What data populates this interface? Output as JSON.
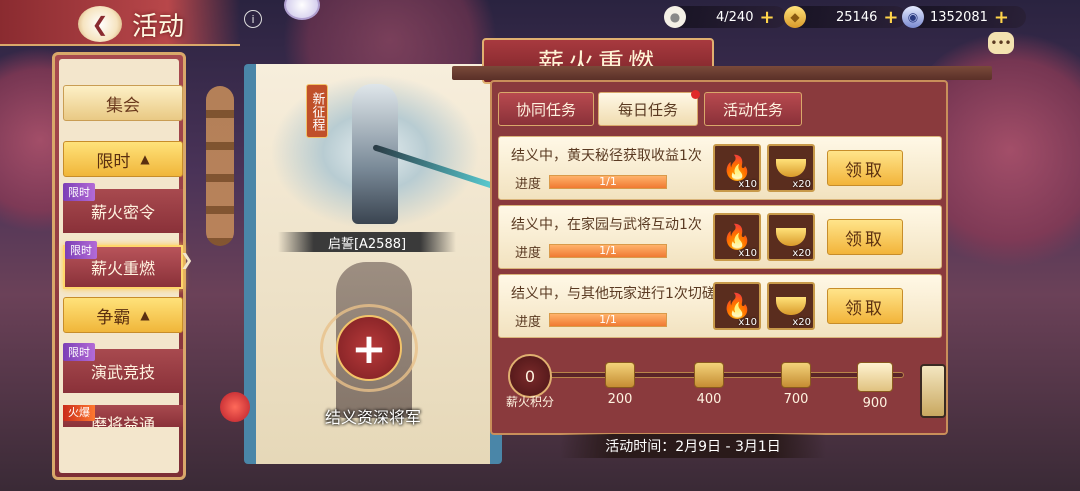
{
  "header": {
    "title": "活动"
  },
  "resources": [
    {
      "value": "4/240",
      "icon": "bun-icon"
    },
    {
      "value": "25146",
      "icon": "gold-ingot-icon"
    },
    {
      "value": "1352081",
      "icon": "silver-coin-icon"
    }
  ],
  "sidebar": {
    "groups": [
      {
        "label": "集会"
      },
      {
        "label": "限时",
        "chevron": "▲"
      },
      {
        "label": "争霸",
        "chevron": "▲"
      }
    ],
    "items": [
      {
        "tag": "限时",
        "label": "薪火密令"
      },
      {
        "tag": "限时",
        "label": "薪火重燃"
      },
      {
        "tag": "限时",
        "label": "演武竞技"
      },
      {
        "tag": "火爆",
        "label": "磨将益通"
      }
    ]
  },
  "hero": {
    "badge": "新征程",
    "name": "启誓[A2588]",
    "add_label": "结义资深将军"
  },
  "event": {
    "banner": "薪火重燃",
    "tabs": [
      "协同任务",
      "每日任务",
      "活动任务"
    ],
    "active_tab": 1,
    "tasks": [
      {
        "title": "结义中，黄天秘径获取收益1次",
        "progress_label": "进度",
        "progress": "1/1",
        "progress_fraction": 1.0,
        "rewards": [
          {
            "icon": "fire-bowl-icon",
            "qty": "x10"
          },
          {
            "icon": "gold-ingot-icon",
            "qty": "x20"
          }
        ],
        "button": "领取"
      },
      {
        "title": "结义中，在家园与武将互动1次",
        "progress_label": "进度",
        "progress": "1/1",
        "progress_fraction": 1.0,
        "rewards": [
          {
            "icon": "fire-bowl-icon",
            "qty": "x10"
          },
          {
            "icon": "gold-ingot-icon",
            "qty": "x20"
          }
        ],
        "button": "领取"
      },
      {
        "title": "结义中，与其他玩家进行1次切磋",
        "progress_label": "进度",
        "progress": "1/1",
        "progress_fraction": 1.0,
        "rewards": [
          {
            "icon": "fire-bowl-icon",
            "qty": "x10"
          },
          {
            "icon": "gold-ingot-icon",
            "qty": "x20"
          }
        ],
        "button": "领取"
      }
    ],
    "score": {
      "value": "0",
      "label": "薪火积分"
    },
    "milestones": [
      "200",
      "400",
      "700",
      "900"
    ],
    "time": "活动时间：2月9日 - 3月1日"
  },
  "colors": {
    "accent": "#f2b43a",
    "panel": "#8a3a3d",
    "paper": "#f3e6cc"
  }
}
